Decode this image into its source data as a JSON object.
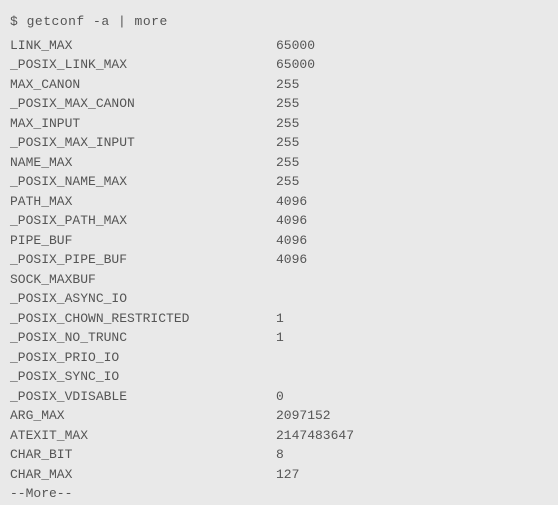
{
  "command": {
    "prompt": "$",
    "text": "getconf -a | more"
  },
  "rows": [
    {
      "name": "LINK_MAX",
      "value": "65000"
    },
    {
      "name": "_POSIX_LINK_MAX",
      "value": "65000"
    },
    {
      "name": "MAX_CANON",
      "value": "255"
    },
    {
      "name": "_POSIX_MAX_CANON",
      "value": "255"
    },
    {
      "name": "MAX_INPUT",
      "value": "255"
    },
    {
      "name": "_POSIX_MAX_INPUT",
      "value": "255"
    },
    {
      "name": "NAME_MAX",
      "value": "255"
    },
    {
      "name": "_POSIX_NAME_MAX",
      "value": "255"
    },
    {
      "name": "PATH_MAX",
      "value": "4096"
    },
    {
      "name": "_POSIX_PATH_MAX",
      "value": "4096"
    },
    {
      "name": "PIPE_BUF",
      "value": "4096"
    },
    {
      "name": "_POSIX_PIPE_BUF",
      "value": "4096"
    },
    {
      "name": "SOCK_MAXBUF",
      "value": ""
    },
    {
      "name": "_POSIX_ASYNC_IO",
      "value": ""
    },
    {
      "name": "_POSIX_CHOWN_RESTRICTED",
      "value": "1"
    },
    {
      "name": "_POSIX_NO_TRUNC",
      "value": "1"
    },
    {
      "name": "_POSIX_PRIO_IO",
      "value": ""
    },
    {
      "name": "_POSIX_SYNC_IO",
      "value": ""
    },
    {
      "name": "_POSIX_VDISABLE",
      "value": "0"
    },
    {
      "name": "ARG_MAX",
      "value": "2097152"
    },
    {
      "name": "ATEXIT_MAX",
      "value": "2147483647"
    },
    {
      "name": "CHAR_BIT",
      "value": "8"
    },
    {
      "name": "CHAR_MAX",
      "value": "127"
    }
  ],
  "pager": {
    "more": "--More--"
  }
}
